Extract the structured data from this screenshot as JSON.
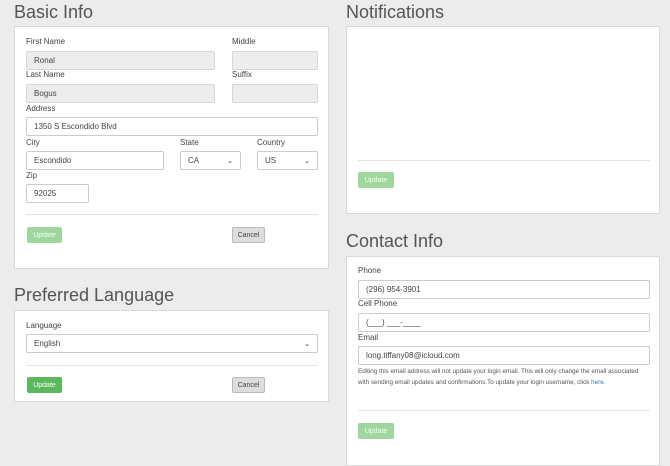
{
  "basic_info": {
    "title": "Basic Info",
    "first_name_label": "First Name",
    "first_name_value": "Ronal",
    "middle_label": "Middle",
    "middle_value": "",
    "last_name_label": "Last Name",
    "last_name_value": "Bogus",
    "suffix_label": "Suffix",
    "suffix_value": "",
    "address_label": "Address",
    "address_value": "1350 S Escondido Blvd",
    "city_label": "City",
    "city_value": "Escondido",
    "state_label": "State",
    "state_value": "CA",
    "country_label": "Country",
    "country_value": "US",
    "zip_label": "Zip",
    "zip_value": "92025",
    "update_label": "Update",
    "cancel_label": "Cancel"
  },
  "preferred_language": {
    "title": "Preferred Language",
    "language_label": "Language",
    "language_value": "English",
    "update_label": "Update",
    "cancel_label": "Cancel"
  },
  "notifications": {
    "title": "Notifications",
    "update_label": "Update"
  },
  "contact_info": {
    "title": "Contact Info",
    "phone_label": "Phone",
    "phone_value": "(296) 954-3901",
    "cell_label": "Cell Phone",
    "cell_value": "(___) ___-____",
    "email_label": "Email",
    "email_value": "long.tiffany08@icloud.com",
    "note_text": "Editing this email address will not update your login email. This will only change the email associated with sending email updates and confirmations.To update your login username, click",
    "note_link": "here.",
    "update_label": "Update"
  },
  "colors": {
    "success": "#5cb85c",
    "success_disabled": "#9ed69e",
    "link": "#337ab7"
  }
}
